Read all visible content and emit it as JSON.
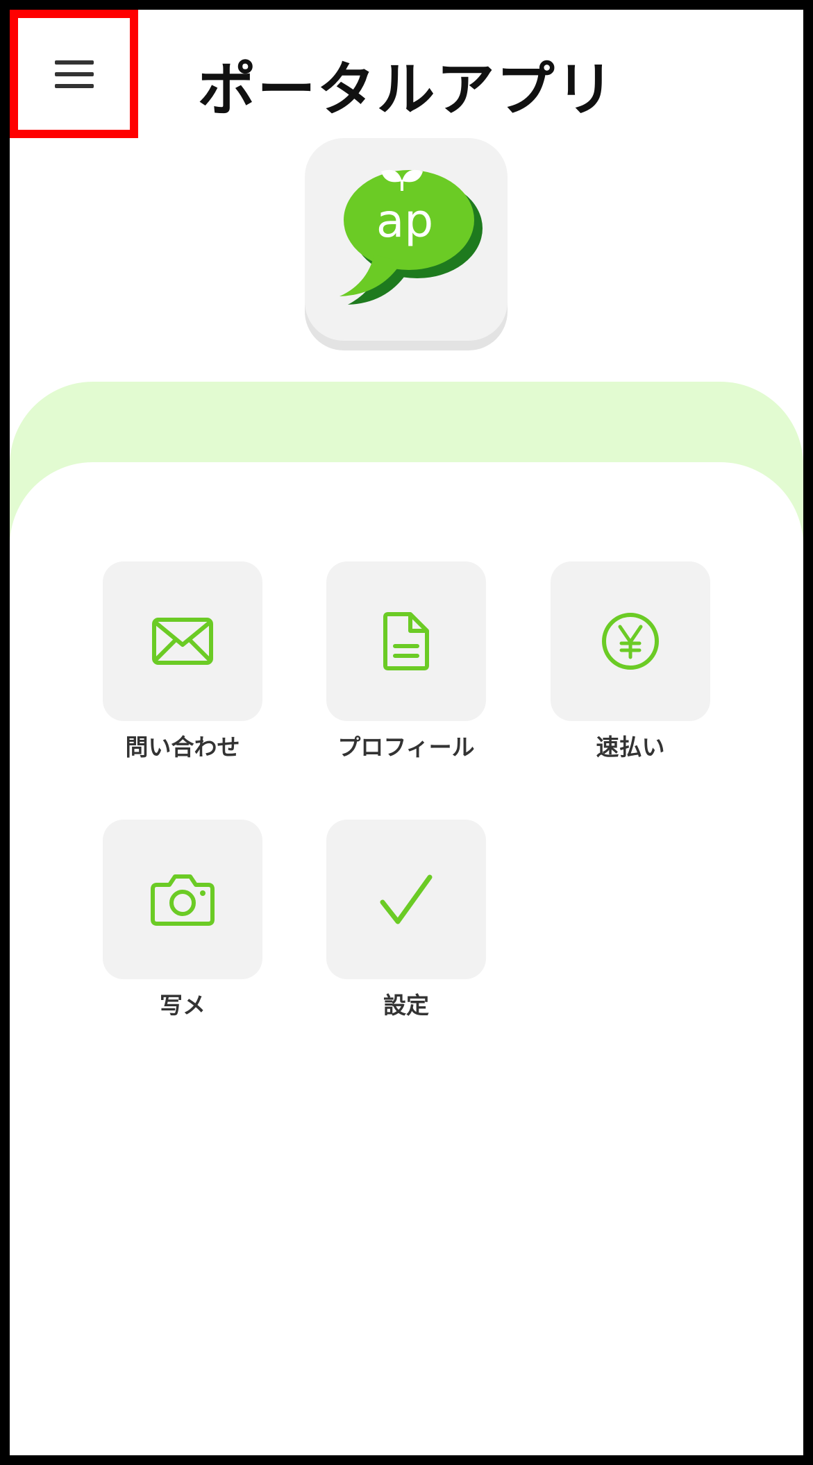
{
  "header": {
    "title": "ポータルアプリ",
    "menu_icon": "hamburger-menu-icon"
  },
  "logo": {
    "text": "ap",
    "icon": "sprout-speech-bubble-logo",
    "colors": {
      "bubble": "#6bcb25",
      "shadow": "#1e7a1e",
      "text": "#ffffff"
    }
  },
  "menu": {
    "items": [
      {
        "label": "問い合わせ",
        "icon": "envelope-icon"
      },
      {
        "label": "プロフィール",
        "icon": "document-icon"
      },
      {
        "label": "速払い",
        "icon": "yen-coin-icon"
      },
      {
        "label": "写メ",
        "icon": "camera-icon"
      },
      {
        "label": "設定",
        "icon": "checkmark-icon"
      }
    ]
  },
  "colors": {
    "accent": "#6bcb25",
    "band": "#e2fbd1",
    "tile": "#f2f2f2",
    "highlight": "#ff0000"
  }
}
